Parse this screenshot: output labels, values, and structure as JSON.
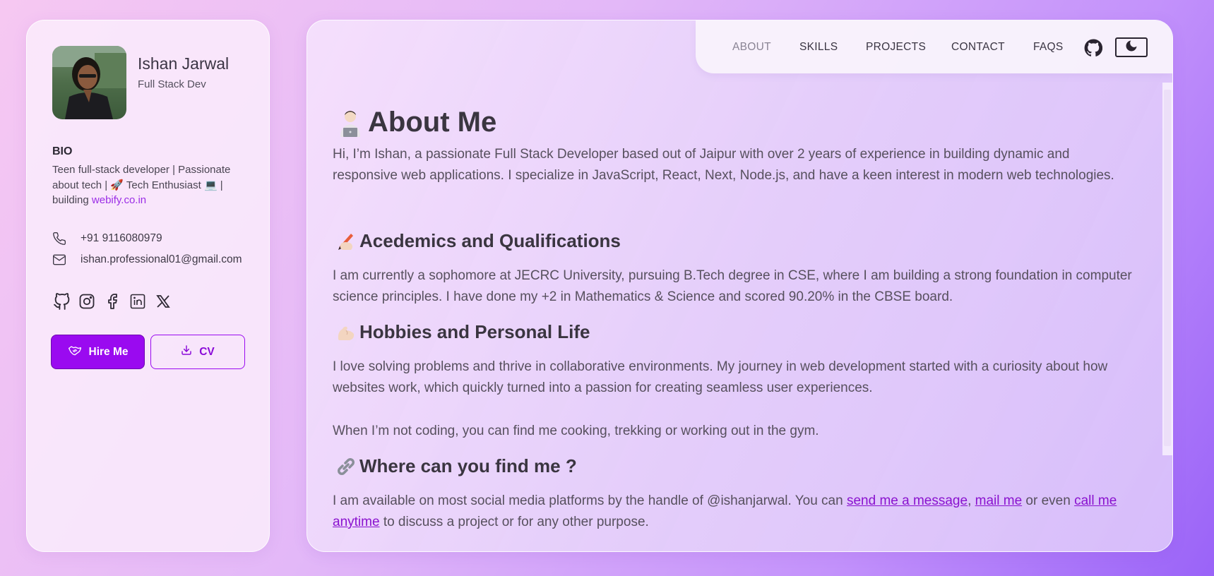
{
  "profile": {
    "name": "Ishan Jarwal",
    "role": "Full Stack Dev",
    "bio_title": "BIO",
    "bio_text_1": "Teen full-stack developer | Passionate about tech | ",
    "bio_emoji_1": "🚀",
    "bio_text_2": " Tech Enthusiast ",
    "bio_emoji_2": "💻",
    "bio_text_3": " | building ",
    "bio_link": "webify.co.in",
    "phone": "+91 9116080979",
    "email": "ishan.professional01@gmail.com",
    "socials": [
      "github-icon",
      "instagram-icon",
      "facebook-icon",
      "linkedin-icon",
      "x-icon"
    ],
    "hire_label": "Hire Me",
    "cv_label": "CV"
  },
  "nav": {
    "items": [
      "ABOUT",
      "SKILLS",
      "PROJECTS",
      "CONTACT",
      "FAQS"
    ],
    "active": "ABOUT"
  },
  "main": {
    "title_emoji": "🧑‍💻",
    "title": "About Me",
    "intro": "Hi, I’m Ishan, a passionate Full Stack Developer based out of Jaipur with over 2 years of experience in building dynamic and responsive web applications. I specialize in JavaScript, React, Next, Node.js, and have a keen interest in modern web technologies.",
    "sections": [
      {
        "emoji": "✍",
        "heading": "Acedemics and Qualifications",
        "text": "I am currently a sophomore at JECRC University, pursuing B.Tech degree in CSE, where I am building a strong foundation in computer science principles. I have done my +2 in Mathematics & Science and scored 90.20% in the CBSE board."
      },
      {
        "emoji": "💪",
        "heading": "Hobbies and Personal Life",
        "text": "I love solving problems and thrive in collaborative environments. My journey in web development started with a curiosity about how websites work, which quickly turned into a passion for creating seamless user experiences.",
        "text2": "When I’m not coding, you can find me cooking, trekking or working out in the gym."
      },
      {
        "emoji": "🔗",
        "heading": "Where can you find me ?",
        "text_a": "I am available on most social media platforms by the handle of @ishanjarwal. You can ",
        "link_message": "send me a message",
        "text_b": ", ",
        "link_mail": "mail me",
        "text_c": " or even ",
        "link_call": "call me anytime",
        "text_d": " to discuss a project or for any other purpose."
      }
    ]
  },
  "colors": {
    "accent": "#9a0af0",
    "link": "#8a12cf"
  }
}
